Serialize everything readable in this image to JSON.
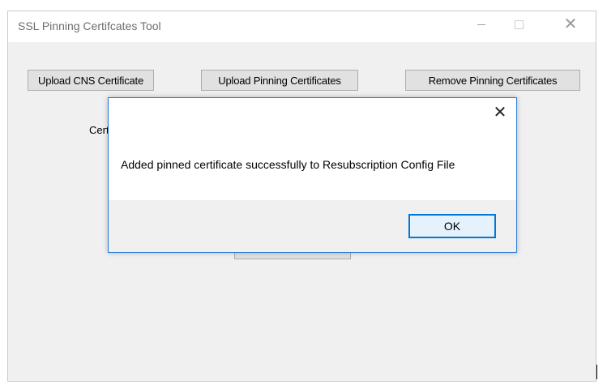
{
  "window": {
    "title": "SSL Pinning Certifcates Tool",
    "controls": {
      "minimize": "–",
      "maximize": "□",
      "close": "✕"
    }
  },
  "toolbar": {
    "upload_cns": "Upload CNS Certificate",
    "upload_pinning": "Upload Pinning Certificates",
    "remove_pinning": "Remove Pinning Certificates"
  },
  "main": {
    "cert_label": "Cert"
  },
  "dialog": {
    "close": "✕",
    "message": "Added pinned certificate successfully to Resubscription Config File",
    "ok_label": "OK"
  }
}
